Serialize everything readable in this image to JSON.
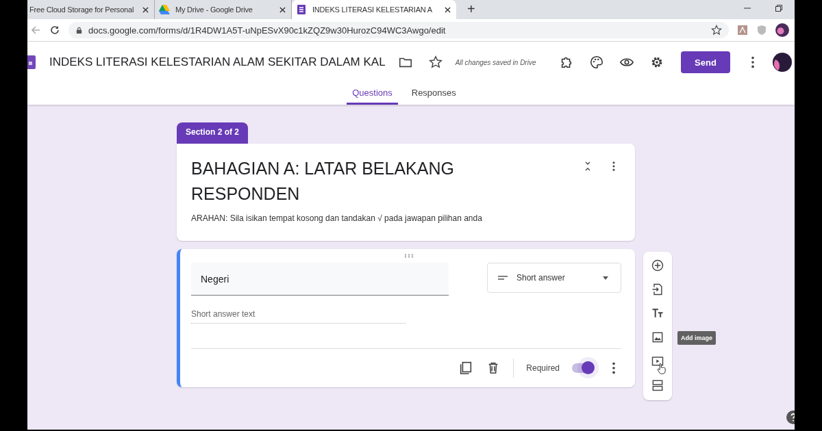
{
  "browser": {
    "tabs": [
      {
        "kind": "page",
        "title": "Free Cloud Storage for Personal",
        "selected": false
      },
      {
        "kind": "drive",
        "title": "My Drive - Google Drive",
        "selected": false
      },
      {
        "kind": "forms",
        "title": "INDEKS LITERASI KELESTARIAN A",
        "selected": true
      }
    ],
    "new_tab": "+",
    "url": "docs.google.com/forms/d/1R4DW1A5T-uNpESvX90c1kZQZ9w30HurozC94WC3Awgo/edit"
  },
  "form_header": {
    "title": "INDEKS LITERASI KELESTARIAN ALAM SEKITAR DALAM KAL",
    "save_status": "All changes saved in Drive",
    "send_label": "Send",
    "view_tabs": [
      {
        "label": "Questions",
        "selected": true
      },
      {
        "label": "Responses",
        "selected": false
      }
    ]
  },
  "section": {
    "tag": "Section 2 of 2",
    "title": "BAHAGIAN A: LATAR BELAKANG RESPONDEN",
    "description": "ARAHAN: Sila isikan tempat kosong dan tandakan √ pada jawapan pilihan anda"
  },
  "question": {
    "title": "Negeri",
    "type": "Short answer",
    "answer_placeholder": "Short answer text",
    "required_label": "Required",
    "required": true
  },
  "tooltip": "Add image"
}
